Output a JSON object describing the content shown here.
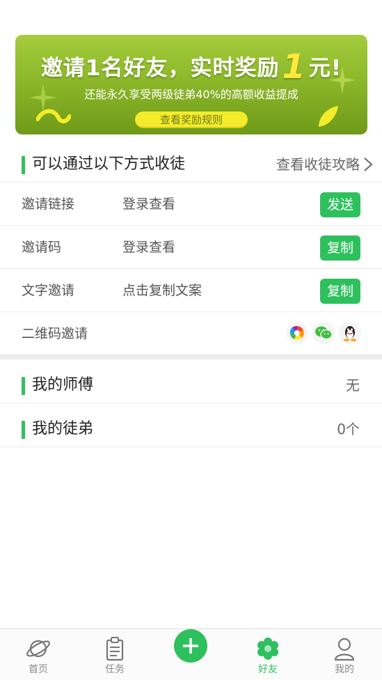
{
  "banner": {
    "headline_pre": "邀请1名好友，实时奖励",
    "headline_num": "1",
    "headline_post": "元!",
    "subtitle": "还能永久享受两级徒弟40%的高额收益提成",
    "button_label": "查看奖励规则",
    "colors": {
      "top": "#a5cc3c",
      "bottom": "#6f9a18",
      "button": "#f4ec2b"
    }
  },
  "recruit": {
    "title": "可以通过以下方式收徒",
    "guide_link": "查看收徒攻略",
    "rows": [
      {
        "label": "邀请链接",
        "value": "登录查看",
        "action": "发送"
      },
      {
        "label": "邀请码",
        "value": "登录查看",
        "action": "复制"
      },
      {
        "label": "文字邀请",
        "value": "点击复制文案",
        "action": "复制"
      },
      {
        "label": "二维码邀请",
        "icons": [
          "moments-icon",
          "wechat-icon",
          "qq-icon"
        ]
      }
    ]
  },
  "master": {
    "title": "我的师傅",
    "value": "无"
  },
  "apprentices": {
    "title": "我的徒弟",
    "value": "0个"
  },
  "tabbar": {
    "items": [
      {
        "label": "首页",
        "icon": "planet-icon"
      },
      {
        "label": "任务",
        "icon": "clipboard-icon"
      },
      {
        "label": "",
        "icon": "plus-icon"
      },
      {
        "label": "好友",
        "icon": "flower-icon",
        "active": true
      },
      {
        "label": "我的",
        "icon": "user-icon"
      }
    ]
  },
  "accent_color": "#2fc05e"
}
